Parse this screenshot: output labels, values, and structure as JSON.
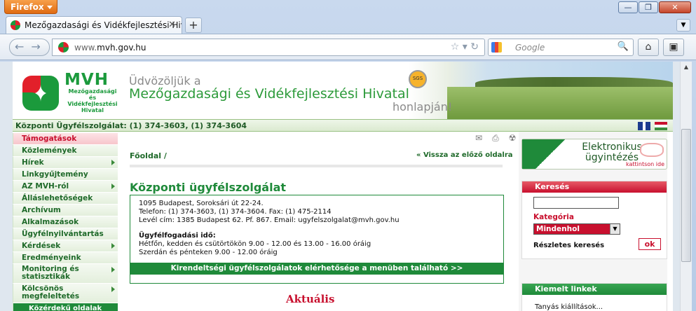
{
  "browser": {
    "menu_label": "Firefox",
    "tab_title": "Mezőgazdasági és Vidékfejlesztési Hivatal",
    "url_prefix": "www.",
    "url_domain": "mvh.gov.hu",
    "search_placeholder": "Google",
    "new_tab": "+",
    "window_controls": [
      "—",
      "❐",
      "✕"
    ]
  },
  "header": {
    "logo_text": "MVH",
    "logo_sub": "Mezőgazdasági és Vidékfejlesztési Hivatal",
    "welcome_line1": "Üdvözöljük a",
    "welcome_line2": "Mezőgazdasági és Vidékfejlesztési Hivatal",
    "welcome_line3": "honlapján!",
    "sgs": "SGS"
  },
  "infobar": {
    "text": "Központi Ügyfélszolgálat: (1) 374-3603, (1) 374-3604"
  },
  "menu": {
    "items": [
      {
        "label": "Támogatások",
        "active": true,
        "arrow": false
      },
      {
        "label": "Közlemények",
        "arrow": false
      },
      {
        "label": "Hírek",
        "arrow": true
      },
      {
        "label": "Linkgyűjtemény",
        "arrow": false
      },
      {
        "label": "AZ MVH-ról",
        "arrow": true
      },
      {
        "label": "Álláslehetőségek",
        "arrow": false
      },
      {
        "label": "Archívum",
        "arrow": false
      },
      {
        "label": "Alkalmazások",
        "arrow": false
      },
      {
        "label": "Ügyfélnyilvántartás",
        "arrow": false
      },
      {
        "label": "Kérdések",
        "arrow": true
      },
      {
        "label": "Eredményeink",
        "arrow": false
      }
    ],
    "two_line": [
      {
        "label": "Monitoring és statisztikák",
        "arrow": true
      },
      {
        "label": "Kölcsönös megfeleltetés",
        "arrow": true
      }
    ],
    "sub_item": "Közérdekű oldalak"
  },
  "main": {
    "breadcrumb": "Főoldal /",
    "back_link": "« Vissza az előző oldalra",
    "title": "Központi ügyfélszolgálat",
    "address": "1095 Budapest, Soroksári út 22-24.",
    "phone": "Telefon: (1) 374-3603, (1) 374-3604. Fax: (1) 475-2114",
    "mail": "Levél cím: 1385 Budapest 62. Pf. 867. Email: ugyfelszolgalat@mvh.gov.hu",
    "hours_label": "Ügyfélfogadási idő:",
    "hours1": "Hétfőn, kedden és csütörtökön 9.00 - 12.00 és 13.00 - 16.00 óráig",
    "hours2": "Szerdán és pénteken 9.00 - 12.00 óráig",
    "bar_link": "Kirendeltségi ügyfélszolgálatok elérhetősége a menüben található >>",
    "aktualis": "Aktuális"
  },
  "right": {
    "e_title": "Elektronikus ügyintézés",
    "e_sub": "kattintson ide",
    "search_head": "Keresés",
    "category_label": "Kategória",
    "category_value": "Mindenhol",
    "detailed": "Részletes keresés",
    "ok": "ok",
    "featured_head": "Kiemelt linkek",
    "featured_text": "Tanyás kiállítások..."
  },
  "colors": {
    "green": "#1f8a3a",
    "red": "#c8102e"
  }
}
